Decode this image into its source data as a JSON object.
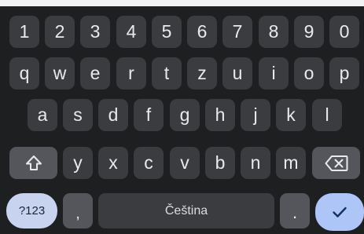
{
  "keyboard": {
    "number_row": [
      "1",
      "2",
      "3",
      "4",
      "5",
      "6",
      "7",
      "8",
      "9",
      "0"
    ],
    "row_qwerty": [
      "q",
      "w",
      "e",
      "r",
      "t",
      "z",
      "u",
      "i",
      "o",
      "p"
    ],
    "row_asdf": [
      "a",
      "s",
      "d",
      "f",
      "g",
      "h",
      "j",
      "k",
      "l"
    ],
    "row_yxcv": [
      "y",
      "x",
      "c",
      "v",
      "b",
      "n",
      "m"
    ],
    "shift_icon": "shift-arrow-icon",
    "backspace_icon": "backspace-icon",
    "symbols_label": "?123",
    "comma_label": ",",
    "space_label": "Čeština",
    "period_label": ".",
    "enter_icon": "checkmark-icon"
  },
  "colors": {
    "keyboard_bg": "#1e1f21",
    "key_bg": "#3b3c3f",
    "special_key_bg": "#54565c",
    "symbols_key_bg": "#c8d3ef",
    "enter_key_bg": "#aec6f7"
  }
}
